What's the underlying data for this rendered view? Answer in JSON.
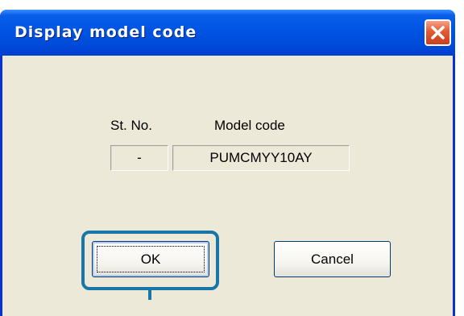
{
  "window": {
    "title": "Display model code",
    "close_icon": "close-icon"
  },
  "table": {
    "headers": {
      "station_no": "St. No.",
      "model_code": "Model code"
    },
    "row": {
      "station_no": "-",
      "model_code": "PUMCMYY10AY"
    }
  },
  "buttons": {
    "ok": "OK",
    "cancel": "Cancel"
  },
  "colors": {
    "titlebar": "#0054e3",
    "dialog_face": "#ece9d8",
    "close_button": "#e35a32",
    "callout": "#1877a8"
  }
}
